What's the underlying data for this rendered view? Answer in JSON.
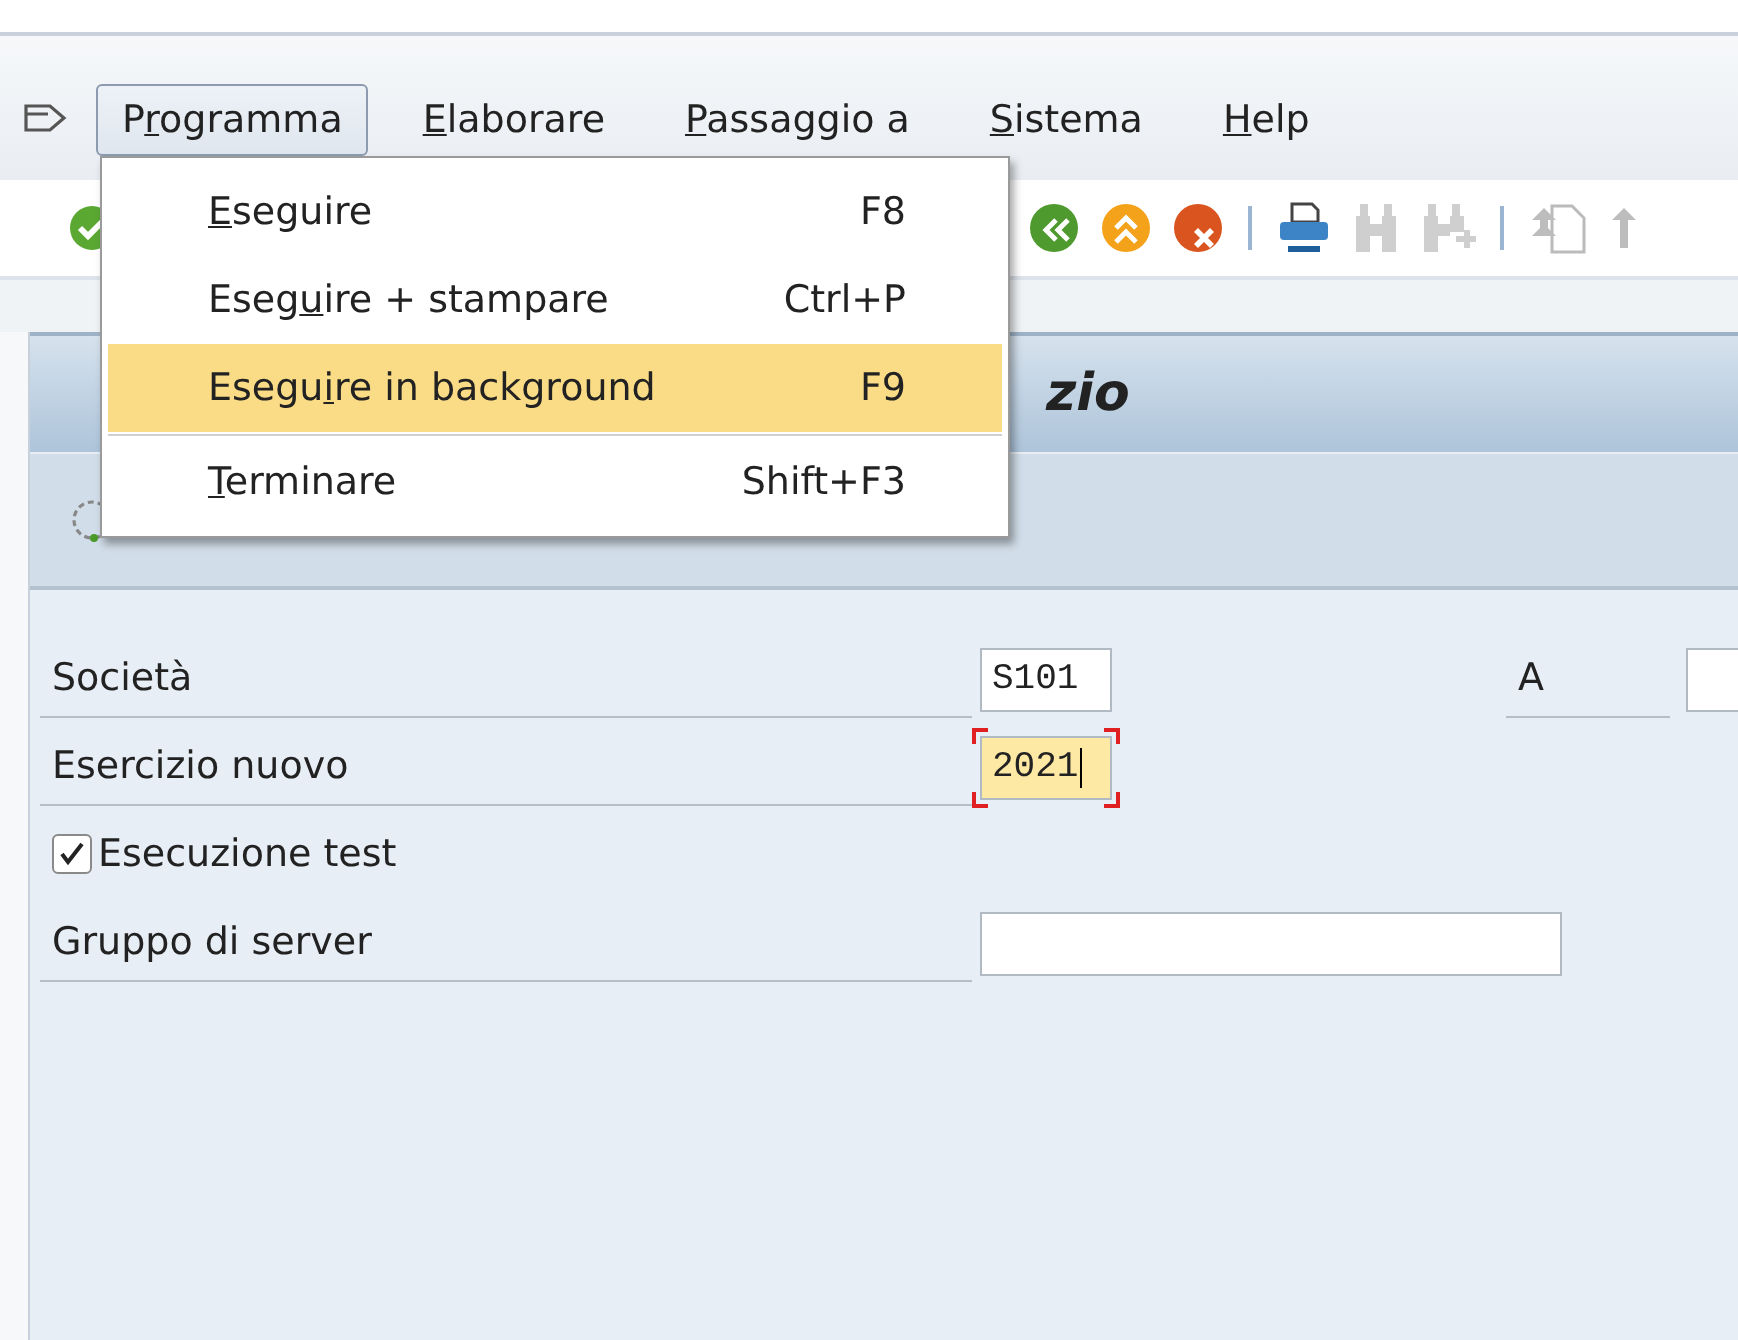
{
  "menu_bar": {
    "items": [
      {
        "pre": "P",
        "key": "r",
        "post": "ogramma",
        "selected": true
      },
      {
        "key": "E",
        "post": "laborare",
        "selected": false
      },
      {
        "key": "P",
        "post": "assaggio a",
        "selected": false
      },
      {
        "key": "S",
        "post": "istema",
        "selected": false
      },
      {
        "key": "H",
        "post": "elp",
        "selected": false
      }
    ]
  },
  "dropdown": {
    "items": [
      {
        "key": "E",
        "post": "seguire",
        "shortcut": "F8",
        "selected": false,
        "separator_before": false
      },
      {
        "pre": "Eseg",
        "key": "u",
        "post": "ire + stampare",
        "shortcut": "Ctrl+P",
        "selected": false,
        "separator_before": false
      },
      {
        "pre": "Esegu",
        "key": "i",
        "post": "re in background",
        "shortcut": "F9",
        "selected": true,
        "separator_before": false
      },
      {
        "key": "T",
        "post": "erminare",
        "shortcut": "Shift+F3",
        "selected": false,
        "separator_before": true
      }
    ]
  },
  "title_bar": {
    "text": "zio"
  },
  "form": {
    "rows": [
      {
        "kind": "code_field",
        "label": "Società",
        "value": "S101",
        "focused": false,
        "side_label": "A"
      },
      {
        "kind": "code_field",
        "label": "Esercizio nuovo",
        "value": "2021",
        "focused": true
      },
      {
        "kind": "checkbox",
        "label": "Esecuzione test",
        "checked": true
      },
      {
        "kind": "text_field",
        "label": "Gruppo di server",
        "focused": false
      }
    ]
  }
}
